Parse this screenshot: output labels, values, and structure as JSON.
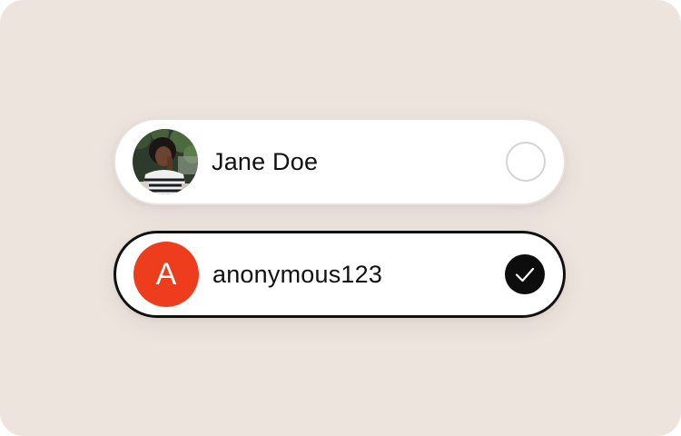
{
  "accounts": [
    {
      "name": "Jane Doe",
      "avatar_type": "photo",
      "selected": false
    },
    {
      "name": "anonymous123",
      "avatar_type": "initial",
      "avatar_initial": "A",
      "avatar_color": "#ee3d1c",
      "selected": true
    }
  ],
  "colors": {
    "background": "#ede4de",
    "selected_border": "#111111",
    "check_fill": "#0d0d0d"
  },
  "icons": {
    "unselected": "empty-radio-icon",
    "selected": "check-circle-icon"
  }
}
